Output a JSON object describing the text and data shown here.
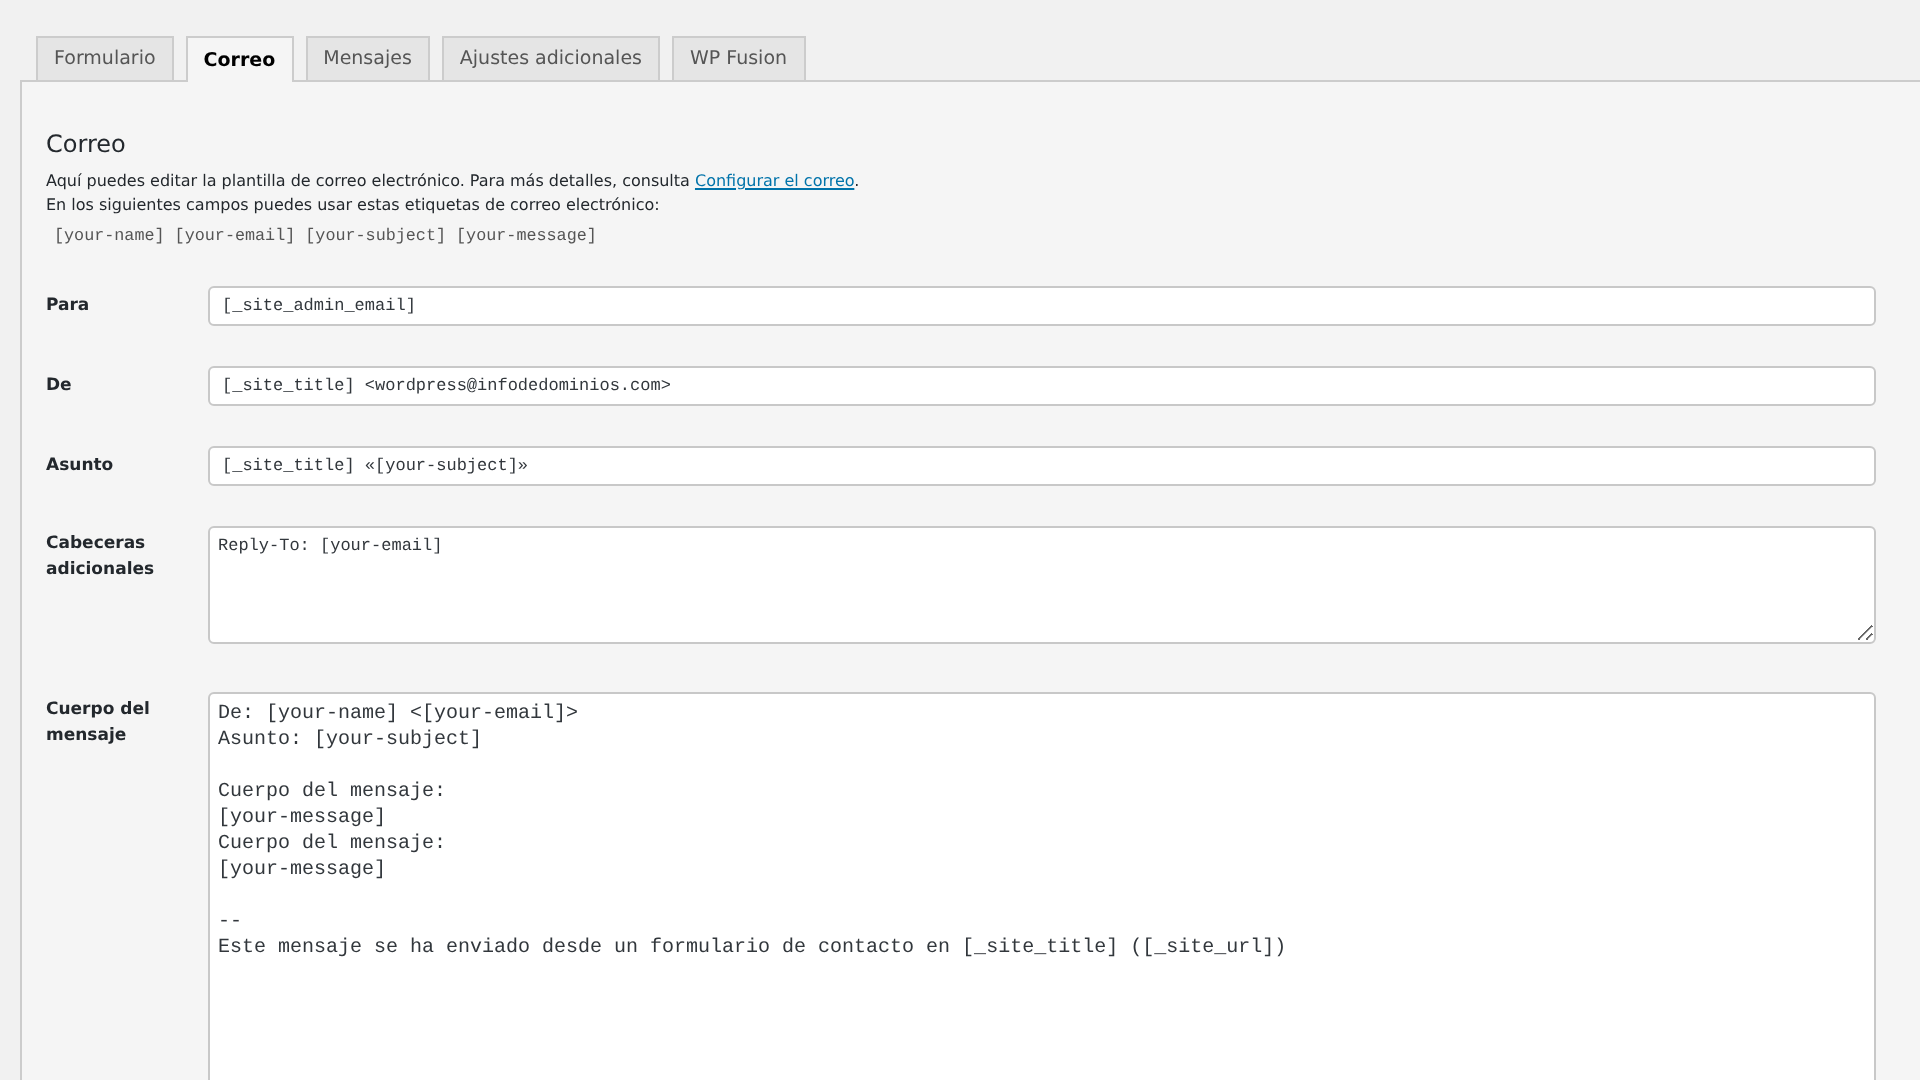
{
  "tabs": [
    {
      "label": "Formulario",
      "selected": false
    },
    {
      "label": "Correo",
      "selected": true
    },
    {
      "label": "Mensajes",
      "selected": false
    },
    {
      "label": "Ajustes adicionales",
      "selected": false
    },
    {
      "label": "WP Fusion",
      "selected": false
    }
  ],
  "panel": {
    "heading": "Correo",
    "description": "Aquí puedes editar la plantilla de correo electrónico. Para más detalles, consulta ",
    "link": "Configurar el correo",
    "link_suffix": ".",
    "tags_intro": "En los siguientes campos puedes usar estas etiquetas de correo electrónico:",
    "tags": "[your-name] [your-email] [your-subject] [your-message]"
  },
  "fields": [
    {
      "kind": "input",
      "label": "Para",
      "value": "[_site_admin_email]"
    },
    {
      "kind": "input",
      "label": "De",
      "value": "[_site_title] <wordpress@infodedominios.com>"
    },
    {
      "kind": "input",
      "label": "Asunto",
      "value": "[_site_title] «[your-subject]»"
    },
    {
      "kind": "textarea",
      "label": "Cabeceras adicionales",
      "value": "Reply-To: [your-email]"
    },
    {
      "kind": "body",
      "label": "Cuerpo del mensaje",
      "value": "De: [your-name] <[your-email]>\nAsunto: [your-subject]\n\nCuerpo del mensaje:\n[your-message]\nCuerpo del mensaje:\n[your-message]\n\n--\nEste mensaje se ha enviado desde un formulario de contacto en [_site_title] ([_site_url])"
    }
  ]
}
